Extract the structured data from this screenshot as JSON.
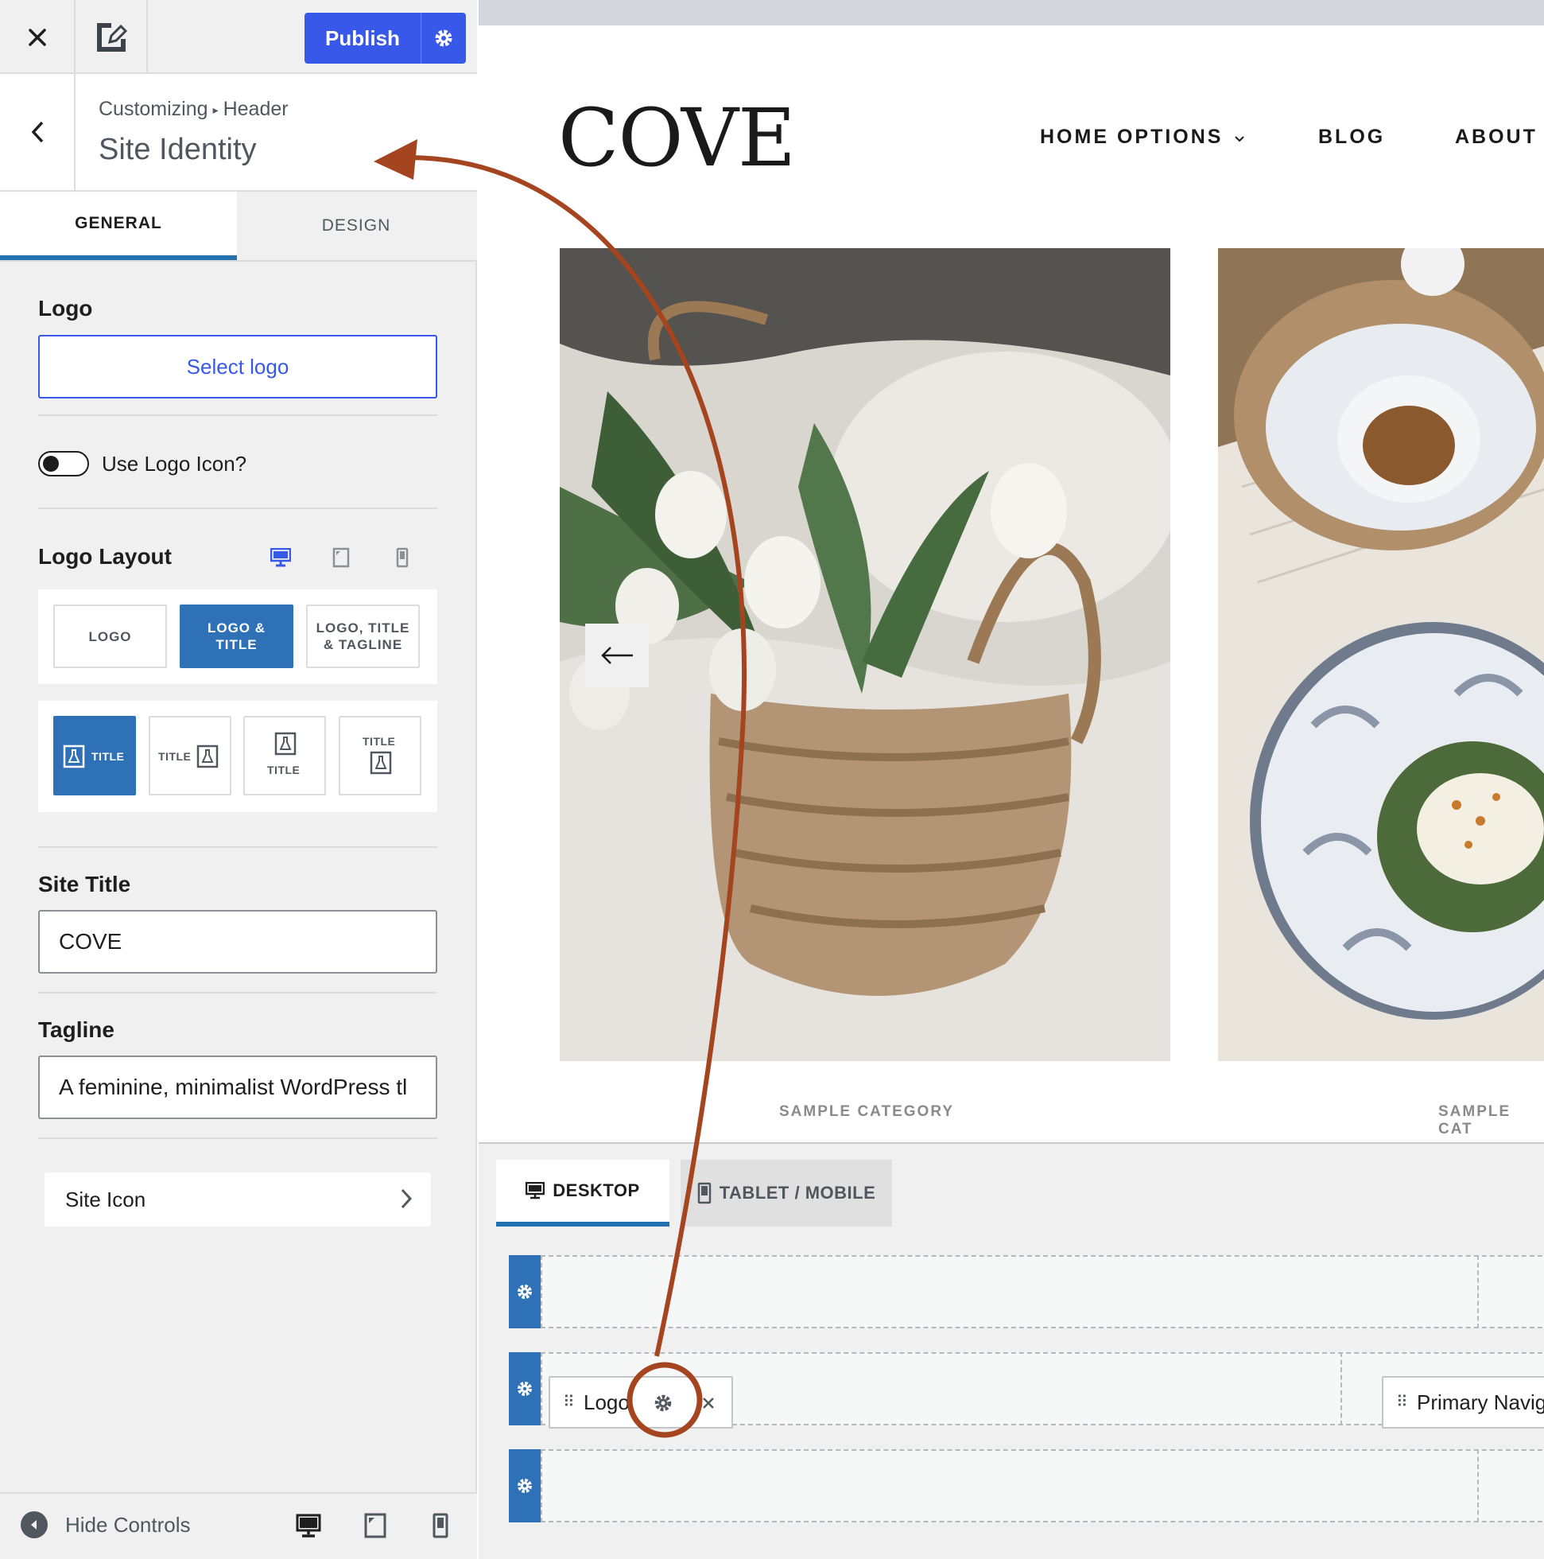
{
  "topbar": {
    "close_icon": "close-icon",
    "edit_icon": "pencil-edit-icon",
    "publish_label": "Publish",
    "publish_settings_icon": "gear-icon"
  },
  "section": {
    "breadcrumb_root": "Customizing",
    "breadcrumb_separator": "▸",
    "breadcrumb_parent": "Header",
    "title": "Site Identity"
  },
  "tabs": [
    "GENERAL",
    "DESIGN"
  ],
  "logo": {
    "label": "Logo",
    "select_button": "Select logo"
  },
  "logo_icon_toggle": {
    "label": "Use Logo Icon?",
    "checked": false
  },
  "logo_layout": {
    "label": "Logo Layout",
    "device_icons": [
      "desktop-icon",
      "tablet-icon",
      "mobile-icon"
    ],
    "options": [
      "LOGO",
      "LOGO &\nTITLE",
      "LOGO, TITLE\n& TAGLINE"
    ],
    "selected_option": 1,
    "arrangements": [
      {
        "text": "TITLE",
        "icon": "flask-icon"
      },
      {
        "text": "TITLE",
        "icon": "flask-icon"
      },
      {
        "text": "TITLE",
        "icon": "flask-icon"
      },
      {
        "text": "TITLE",
        "icon": "flask-icon"
      }
    ],
    "selected_arrangement": 0
  },
  "site_title": {
    "label": "Site Title",
    "value": "COVE"
  },
  "tagline": {
    "label": "Tagline",
    "value": "A feminine, minimalist WordPress tl"
  },
  "site_icon": {
    "label": "Site Icon"
  },
  "footer": {
    "hide_controls": "Hide Controls"
  },
  "preview": {
    "site_title": "COVE",
    "nav": [
      "HOME OPTIONS",
      "BLOG",
      "ABOUT"
    ],
    "categories": [
      "SAMPLE CATEGORY",
      "SAMPLE CAT"
    ]
  },
  "builder": {
    "tabs": [
      "DESKTOP",
      "TABLET / MOBILE"
    ],
    "items": {
      "logo": "Logo",
      "primary_nav": "Primary Navig"
    }
  },
  "colors": {
    "accent": "#3858e9",
    "selected": "#2f71b7",
    "annotation": "#a5451f"
  }
}
